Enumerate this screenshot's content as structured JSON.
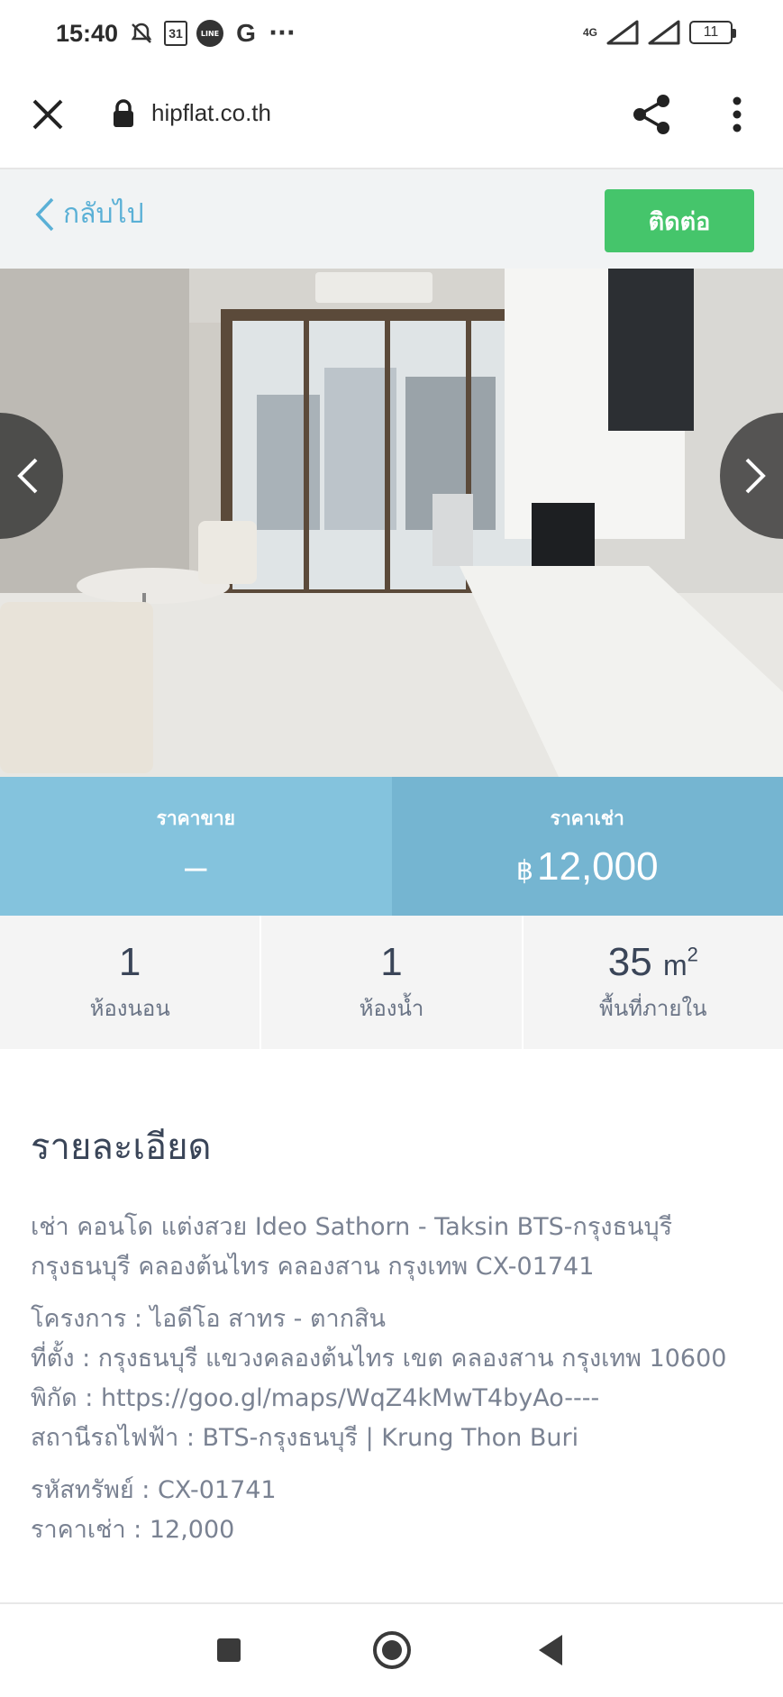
{
  "status_bar": {
    "time": "15:40",
    "calendar_day": "31",
    "line_label": "LINE",
    "g_label": "G",
    "more_dots": "···",
    "network": "4G",
    "battery": "11"
  },
  "browser": {
    "url": "hipflat.co.th"
  },
  "header": {
    "back_label": "กลับไป",
    "contact_label": "ติดต่อ"
  },
  "price": {
    "sale_label": "ราคาขาย",
    "sale_value": "–",
    "rent_label": "ราคาเช่า",
    "currency": "฿",
    "rent_value": "12,000"
  },
  "stats": {
    "bedrooms_value": "1",
    "bedrooms_label": "ห้องนอน",
    "bathrooms_value": "1",
    "bathrooms_label": "ห้องน้ำ",
    "area_value": "35",
    "area_unit": "m",
    "area_sup": "2",
    "area_label": "พื้นที่ภายใน"
  },
  "details": {
    "title": "รายละเอียด",
    "intro": "เช่า คอนโด แต่งสวย Ideo Sathorn - Taksin BTS-กรุงธนบุรี กรุงธนบุรี คลองต้นไทร คลองสาน กรุงเทพ CX-01741",
    "project": "โครงการ : ไอดีโอ สาทร - ตากสิน",
    "location": "ที่ตั้ง : กรุงธนบุรี แขวงคลองต้นไทร เขต คลองสาน กรุงเทพ 10600",
    "coords": "พิกัด : https://goo.gl/maps/WqZ4kMwT4byAo----",
    "station": "สถานีรถไฟฟ้า : BTS-กรุงธนบุรี | Krung Thon Buri",
    "code": "รหัสทรัพย์ : CX-01741",
    "rent_price": "ราคาเช่า : 12,000"
  }
}
